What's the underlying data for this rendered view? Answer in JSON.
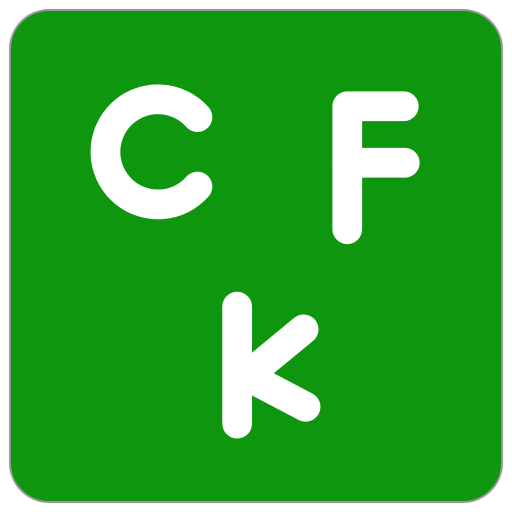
{
  "icon": {
    "background_color": "#0e960e",
    "border_color": "#9a9a9a",
    "letter_color": "#ffffff",
    "letters": [
      "C",
      "F",
      "K"
    ]
  }
}
